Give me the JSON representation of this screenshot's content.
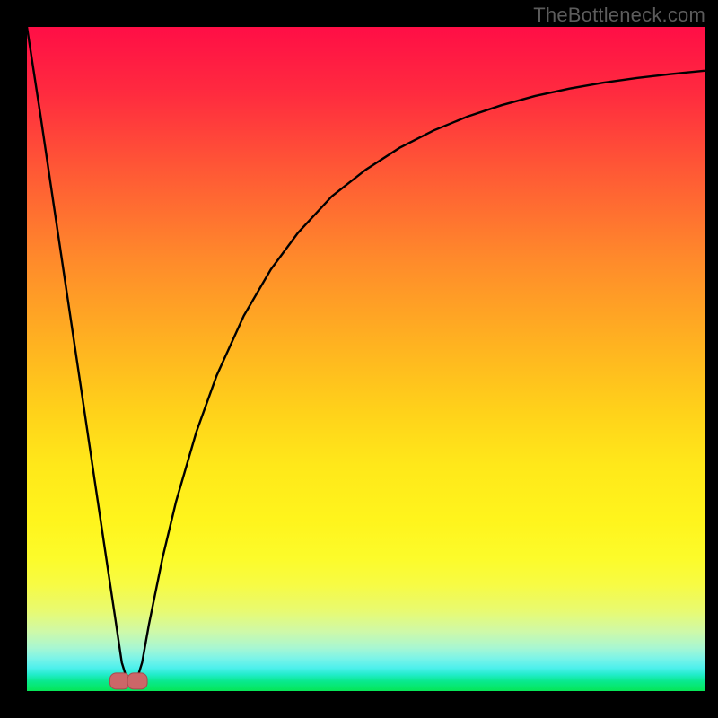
{
  "watermark": "TheBottleneck.com",
  "colors": {
    "frame": "#000000",
    "curve_stroke": "#000000",
    "marker_fill": "#cc6668",
    "marker_stroke": "#a94a4d"
  },
  "chart_data": {
    "type": "line",
    "title": "",
    "xlabel": "",
    "ylabel": "",
    "xlim": [
      0,
      100
    ],
    "ylim": [
      0,
      100
    ],
    "grid": false,
    "legend": false,
    "series": [
      {
        "name": "bottleneck-curve",
        "x": [
          0,
          2,
          4,
          6,
          8,
          10,
          12,
          13,
          14,
          15,
          16,
          17,
          18,
          20,
          22,
          25,
          28,
          32,
          36,
          40,
          45,
          50,
          55,
          60,
          65,
          70,
          75,
          80,
          85,
          90,
          95,
          100
        ],
        "y": [
          100,
          86.7,
          72.9,
          59.2,
          45.5,
          31.7,
          18.0,
          11.2,
          4.3,
          1.0,
          1.0,
          4.3,
          10.0,
          20.0,
          28.5,
          39.0,
          47.5,
          56.5,
          63.5,
          69.0,
          74.5,
          78.5,
          81.8,
          84.4,
          86.5,
          88.2,
          89.6,
          90.7,
          91.6,
          92.3,
          92.9,
          93.4
        ]
      }
    ],
    "markers": [
      {
        "shape": "rounded-square",
        "x": 13.7,
        "y": 1.5,
        "note": "left lobe at valley bottom"
      },
      {
        "shape": "rounded-square",
        "x": 16.3,
        "y": 1.5,
        "note": "right lobe at valley bottom"
      }
    ],
    "background": "vertical-gradient red→orange→yellow→green top-to-bottom"
  }
}
